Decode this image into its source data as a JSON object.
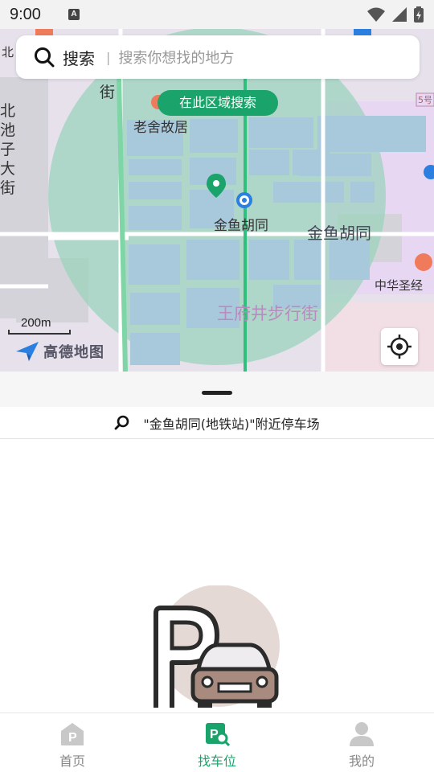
{
  "status_bar": {
    "time": "9:00",
    "notification_icon": "A"
  },
  "map": {
    "labels": {
      "laoshe": "老舍故居",
      "jinyu_station": "金鱼胡同",
      "jinyu_road": "金鱼胡同",
      "wangfujing": "王府井步行街",
      "zhonghua": "中华圣经",
      "bei_street": "北池子大街",
      "jie": "街",
      "bei_top": "北",
      "route_badge": "5号"
    },
    "area_search_button": "在此区域搜索",
    "scale": "200m",
    "provider_logo": "高德地图",
    "search": {
      "label": "搜索",
      "placeholder": "搜索你想找的地方"
    },
    "colors": {
      "radius_fill": "#9ad3bb",
      "accent": "#1aa36a"
    }
  },
  "sheet": {
    "nearby_title": "\"金鱼胡同(地铁站)\"附近停车场"
  },
  "tabs": [
    {
      "label": "首页",
      "icon": "home-parking-icon",
      "active": false
    },
    {
      "label": "找车位",
      "icon": "find-parking-icon",
      "active": true
    },
    {
      "label": "我的",
      "icon": "profile-icon",
      "active": false
    }
  ]
}
